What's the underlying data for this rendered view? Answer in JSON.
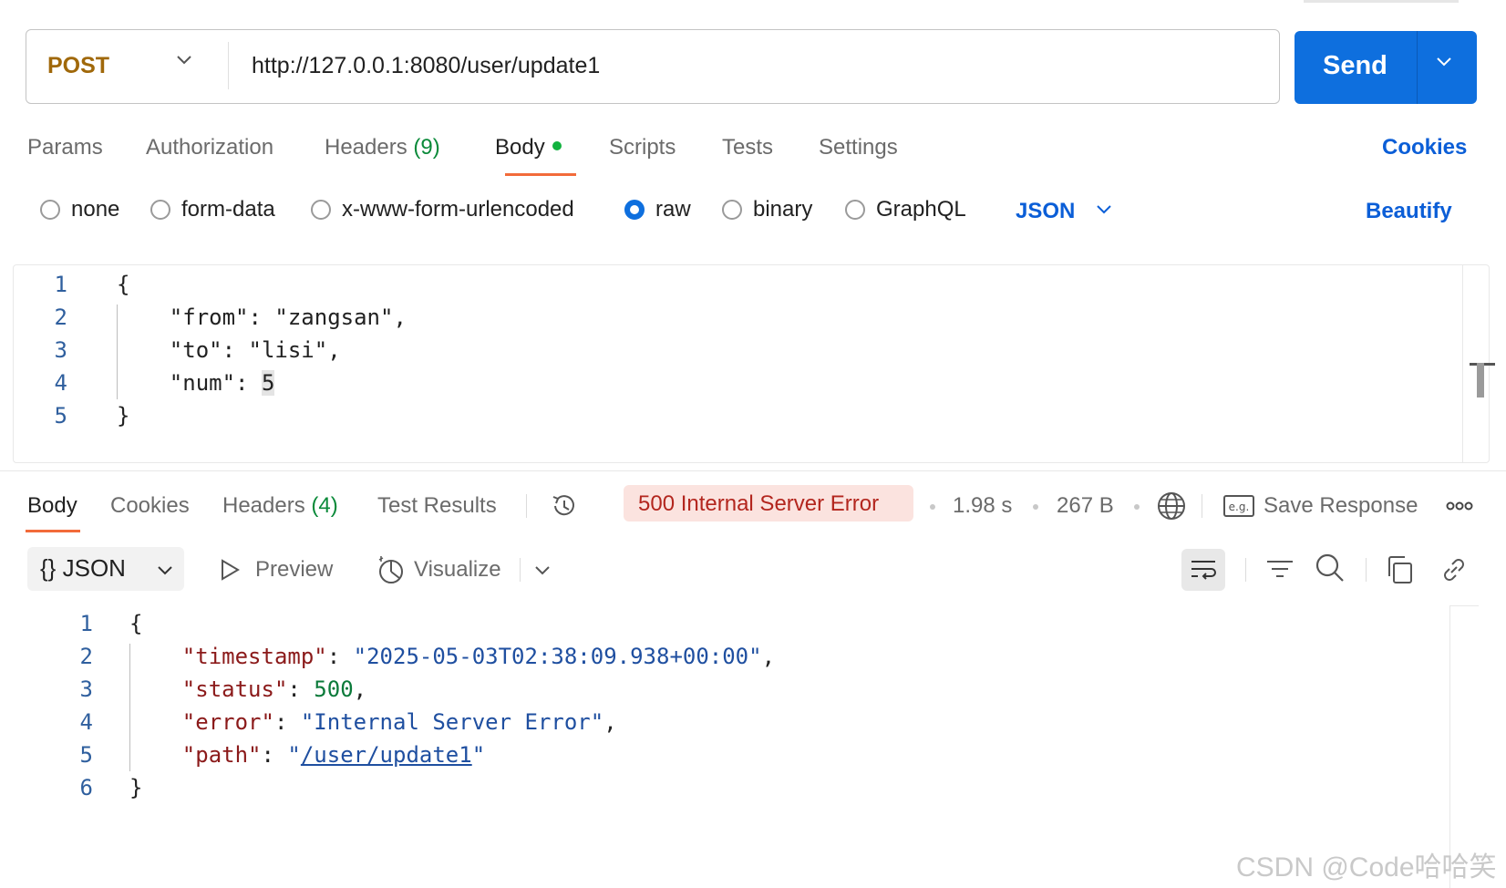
{
  "request": {
    "method": "POST",
    "url": "http://127.0.0.1:8080/user/update1",
    "send_label": "Send"
  },
  "request_tabs": {
    "params": "Params",
    "authorization": "Authorization",
    "headers": "Headers",
    "headers_count": "(9)",
    "body": "Body",
    "scripts": "Scripts",
    "tests": "Tests",
    "settings": "Settings",
    "cookies": "Cookies",
    "active": "Body"
  },
  "body_types": {
    "none": "none",
    "form_data": "form-data",
    "urlencoded": "x-www-form-urlencoded",
    "raw": "raw",
    "binary": "binary",
    "graphql": "GraphQL",
    "selected": "raw",
    "format": "JSON",
    "beautify": "Beautify"
  },
  "request_body": {
    "line_numbers": [
      "1",
      "2",
      "3",
      "4",
      "5"
    ],
    "open": "{",
    "line2_key": "\"from\"",
    "line2_value": "\"zangsan\"",
    "line3_key": "\"to\"",
    "line3_value": "\"lisi\"",
    "line4_key": "\"num\"",
    "line4_value": "5",
    "close": "}"
  },
  "response_tabs": {
    "body": "Body",
    "cookies": "Cookies",
    "headers": "Headers",
    "headers_count": "(4)",
    "test_results": "Test Results",
    "active": "Body"
  },
  "response_meta": {
    "status": "500 Internal Server Error",
    "time": "1.98 s",
    "size": "267 B",
    "save_response": "Save Response"
  },
  "response_toolbar": {
    "format": "JSON",
    "format_braces": "{}",
    "preview": "Preview",
    "visualize": "Visualize"
  },
  "response_body": {
    "line_numbers": [
      "1",
      "2",
      "3",
      "4",
      "5",
      "6"
    ],
    "open": "{",
    "timestamp_key": "\"timestamp\"",
    "timestamp_value": "\"2025-05-03T02:38:09.938+00:00\"",
    "status_key": "\"status\"",
    "status_value": "500",
    "error_key": "\"error\"",
    "error_value": "\"Internal Server Error\"",
    "path_key": "\"path\"",
    "path_value": "/user/update1",
    "close": "}"
  },
  "colors": {
    "accent": "#0e6fde",
    "method": "#a0680a",
    "tab_underline": "#f26b3a",
    "error": "#b3261e",
    "error_bg": "#fbe3df"
  },
  "watermark": "CSDN @Code哈哈笑"
}
